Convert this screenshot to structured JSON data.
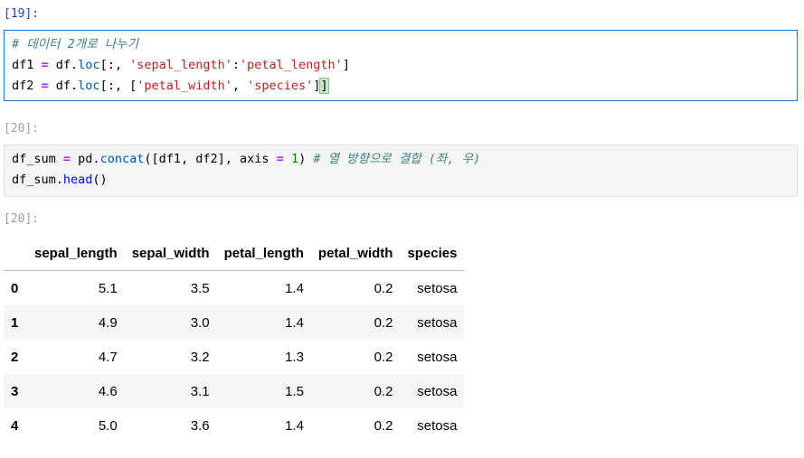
{
  "cells": [
    {
      "prompt": "[19]:",
      "lines": [
        "# 데이터 2개로 나누기",
        "df1 = df.loc[:, 'sepal_length':'petal_length']",
        "df2 = df.loc[:, ['petal_width', 'species']]"
      ]
    },
    {
      "prompt": "[20]:",
      "lines": [
        "df_sum = pd.concat([df1, df2], axis = 1) # 열 방향으로 결합 (좌, 우)",
        "df_sum.head()"
      ]
    }
  ],
  "output": {
    "prompt": "[20]:",
    "columns": [
      "",
      "sepal_length",
      "sepal_width",
      "petal_length",
      "petal_width",
      "species"
    ],
    "rows": [
      [
        "0",
        "5.1",
        "3.5",
        "1.4",
        "0.2",
        "setosa"
      ],
      [
        "1",
        "4.9",
        "3.0",
        "1.4",
        "0.2",
        "setosa"
      ],
      [
        "2",
        "4.7",
        "3.2",
        "1.3",
        "0.2",
        "setosa"
      ],
      [
        "3",
        "4.6",
        "3.1",
        "1.5",
        "0.2",
        "setosa"
      ],
      [
        "4",
        "5.0",
        "3.6",
        "1.4",
        "0.2",
        "setosa"
      ]
    ]
  }
}
